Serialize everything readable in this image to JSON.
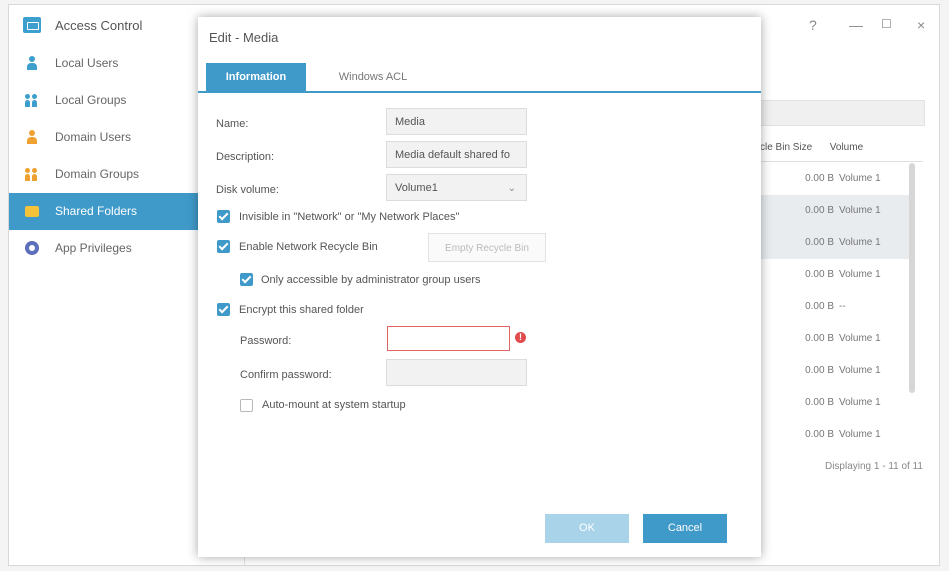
{
  "window": {
    "title": "Access Control"
  },
  "sidebar": {
    "items": [
      {
        "label": "Local Users"
      },
      {
        "label": "Local Groups"
      },
      {
        "label": "Domain Users"
      },
      {
        "label": "Domain Groups"
      },
      {
        "label": "Shared Folders"
      },
      {
        "label": "App Privileges"
      }
    ],
    "active_index": 4
  },
  "grid": {
    "headers": [
      "ycle Bin Size",
      "Volume"
    ],
    "rows": [
      {
        "size": "0.00 B",
        "volume": "Volume 1"
      },
      {
        "size": "0.00 B",
        "volume": "Volume 1"
      },
      {
        "size": "0.00 B",
        "volume": "Volume 1"
      },
      {
        "size": "0.00 B",
        "volume": "Volume 1"
      },
      {
        "size": "0.00 B",
        "volume": "--"
      },
      {
        "size": "0.00 B",
        "volume": "Volume 1"
      },
      {
        "size": "0.00 B",
        "volume": "Volume 1"
      },
      {
        "size": "0.00 B",
        "volume": "Volume 1"
      },
      {
        "size": "0.00 B",
        "volume": "Volume 1"
      }
    ],
    "paging": "Displaying 1 - 11 of 11"
  },
  "dialog": {
    "title": "Edit - Media",
    "tabs": [
      "Information",
      "Windows ACL"
    ],
    "name_label": "Name:",
    "name_value": "Media",
    "description_label": "Description:",
    "description_value": "Media default shared fo",
    "disk_label": "Disk volume:",
    "disk_value": "Volume1",
    "invisible_label": "Invisible in \"Network\" or \"My Network Places\"",
    "recycle_label": "Enable Network Recycle Bin",
    "empty_recycle_label": "Empty Recycle Bin",
    "admin_only_label": "Only accessible by administrator group users",
    "encrypt_label": "Encrypt this shared folder",
    "password_label": "Password:",
    "confirm_label": "Confirm password:",
    "automount_label": "Auto-mount at system startup",
    "ok_label": "OK",
    "cancel_label": "Cancel",
    "error_glyph": "!"
  },
  "colors": {
    "accent": "#3f9ac9",
    "error": "#e24b4b"
  }
}
